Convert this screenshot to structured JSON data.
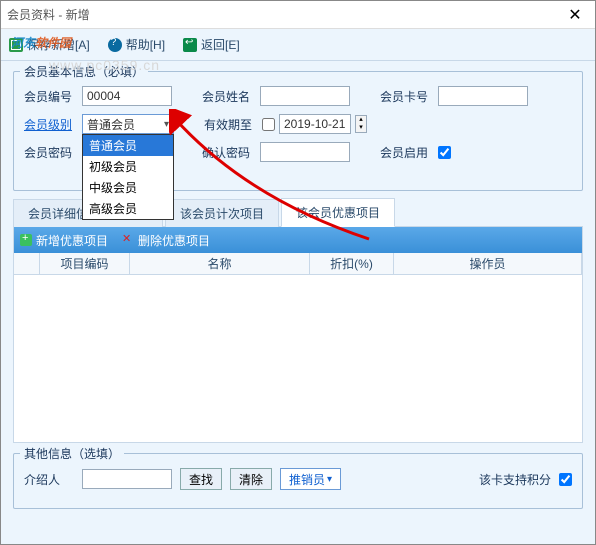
{
  "window": {
    "title": "会员资料 - 新增"
  },
  "toolbar": {
    "save": "保存新增[A]",
    "help": "帮助[H]",
    "back": "返回[E]"
  },
  "basic": {
    "legend": "会员基本信息（必填）",
    "member_no_label": "会员编号",
    "member_no": "00004",
    "member_name_label": "会员姓名",
    "member_name": "",
    "card_no_label": "会员卡号",
    "card_no": "",
    "level_label": "会员级别",
    "level_selected": "普通会员",
    "level_options": [
      "普通会员",
      "初级会员",
      "中级会员",
      "高级会员"
    ],
    "expiry_label": "有效期至",
    "expiry_date": "2019-10-21",
    "password_label": "会员密码",
    "confirm_pwd_label": "确认密码",
    "enable_member_label": "会员启用"
  },
  "tabs": {
    "detail": "会员详细信息（选填）",
    "counts": "该会员计次项目",
    "discount": "该会员优惠项目"
  },
  "discount_panel": {
    "add": "新增优惠项目",
    "del": "删除优惠项目",
    "cols": {
      "code": "项目编码",
      "name": "名称",
      "disc": "折扣(%)",
      "op": "操作员"
    }
  },
  "other": {
    "legend": "其他信息（选填）",
    "referrer_label": "介绍人",
    "find": "查找",
    "clear": "清除",
    "push": "推销员",
    "points_label": "该卡支持积分"
  },
  "watermark": {
    "brand_a": "河东",
    "brand_b": "软件园",
    "url": "www.pc0359.cn"
  }
}
